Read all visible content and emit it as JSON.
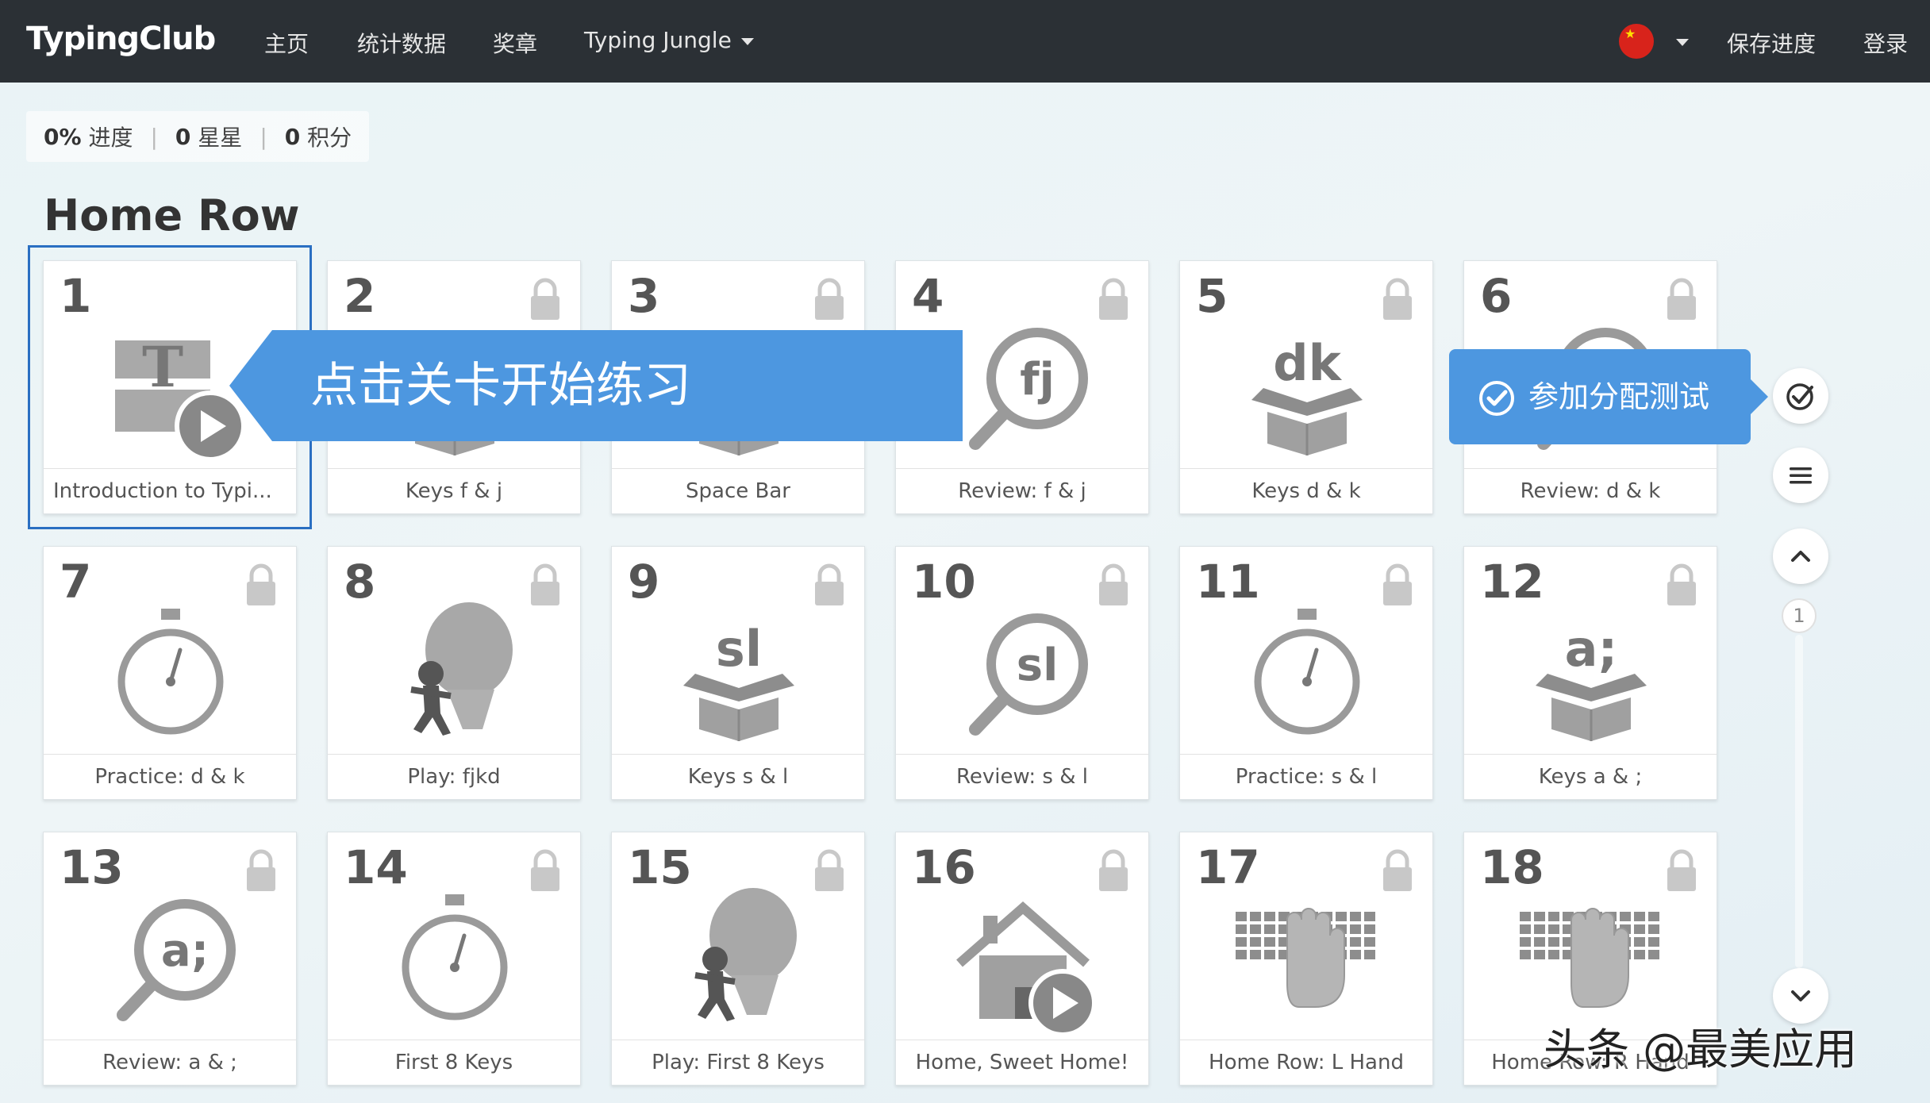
{
  "nav": {
    "brand": "TypingClub",
    "links": [
      "主页",
      "统计数据",
      "奖章"
    ],
    "dropdown": "Typing Jungle",
    "save": "保存进度",
    "login": "登录"
  },
  "progress": {
    "percent": "0%",
    "percent_label": "进度",
    "stars": "0",
    "stars_label": "星星",
    "points": "0",
    "points_label": "积分"
  },
  "section_title": "Home Row",
  "lessons": [
    {
      "num": "1",
      "title": "Introduction to Typi...",
      "icon": "intro-video-icon",
      "locked": false
    },
    {
      "num": "2",
      "title": "Keys f & j",
      "icon": "box-icon",
      "locked": true
    },
    {
      "num": "3",
      "title": "Space Bar",
      "icon": "box-icon",
      "locked": true
    },
    {
      "num": "4",
      "title": "Review: f & j",
      "icon": "magnifier-icon",
      "glyph": "fj",
      "locked": true
    },
    {
      "num": "5",
      "title": "Keys d & k",
      "icon": "box-icon",
      "glyph": "dk",
      "locked": true
    },
    {
      "num": "6",
      "title": "Review: d & k",
      "icon": "magnifier-icon",
      "locked": true
    },
    {
      "num": "7",
      "title": "Practice: d & k",
      "icon": "stopwatch-icon",
      "locked": true
    },
    {
      "num": "8",
      "title": "Play: fjkd",
      "icon": "balloon-game-icon",
      "locked": true
    },
    {
      "num": "9",
      "title": "Keys s & l",
      "icon": "box-icon",
      "glyph": "sl",
      "locked": true
    },
    {
      "num": "10",
      "title": "Review: s & l",
      "icon": "magnifier-icon",
      "glyph": "sl",
      "locked": true
    },
    {
      "num": "11",
      "title": "Practice: s & l",
      "icon": "stopwatch-icon",
      "locked": true
    },
    {
      "num": "12",
      "title": "Keys a & ;",
      "icon": "box-icon",
      "glyph": "a;",
      "locked": true
    },
    {
      "num": "13",
      "title": "Review: a & ;",
      "icon": "magnifier-icon",
      "glyph": "a;",
      "locked": true
    },
    {
      "num": "14",
      "title": "First 8 Keys",
      "icon": "stopwatch-icon",
      "locked": true
    },
    {
      "num": "15",
      "title": "Play: First 8 Keys",
      "icon": "balloon-game-icon",
      "locked": true
    },
    {
      "num": "16",
      "title": "Home, Sweet Home!",
      "icon": "house-video-icon",
      "locked": true
    },
    {
      "num": "17",
      "title": "Home Row: L Hand",
      "icon": "keyboard-hand-icon",
      "locked": true
    },
    {
      "num": "18",
      "title": "Home Row: R Hand",
      "icon": "keyboard-hand-icon",
      "locked": true
    }
  ],
  "tooltips": {
    "main": "点击关卡开始练习",
    "assign": "参加分配测试"
  },
  "page_indicator": "1",
  "watermark": "头条 @最美应用",
  "colors": {
    "navbar": "#2b3035",
    "accent_blue": "#4d97e0",
    "selected_outline": "#2a6fc2",
    "icon_gray": "#9a9a9a"
  }
}
